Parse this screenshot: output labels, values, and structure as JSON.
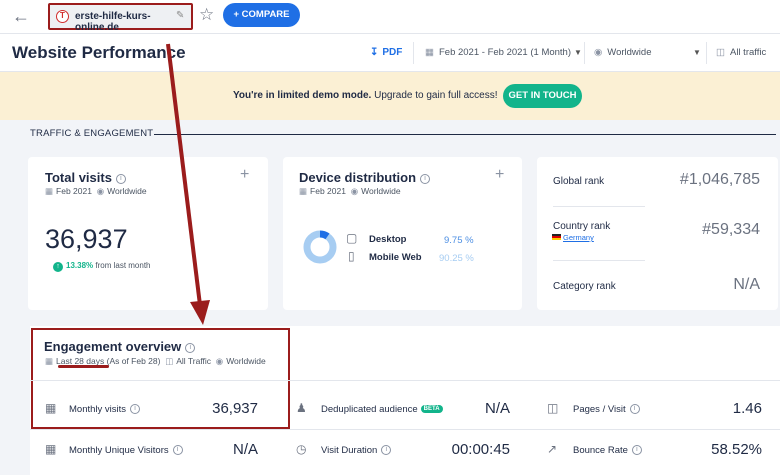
{
  "topbar": {
    "site_name": "erste-hilfe-kurs-online.de",
    "site_favicon_letter": "T",
    "compare_label": "+ COMPARE"
  },
  "header": {
    "title": "Website Performance",
    "pdf_label": "PDF",
    "date_range": "Feb 2021 - Feb 2021 (1 Month)",
    "region": "Worldwide",
    "traffic": "All traffic"
  },
  "banner": {
    "text_bold": "You're in limited demo mode.",
    "text_rest": " Upgrade to gain full access!",
    "cta_label": "GET IN TOUCH"
  },
  "section_label": "TRAFFIC & ENGAGEMENT",
  "total_visits": {
    "title": "Total visits",
    "period": "Feb 2021",
    "region": "Worldwide",
    "value": "36,937",
    "change_pct": "13.38%",
    "change_text": "from last month"
  },
  "device_distribution": {
    "title": "Device distribution",
    "period": "Feb 2021",
    "region": "Worldwide",
    "desktop_label": "Desktop",
    "desktop_pct": "9.75 %",
    "mobile_label": "Mobile Web",
    "mobile_pct": "90.25 %",
    "desktop_fraction": 0.0975
  },
  "ranks": {
    "global_label": "Global rank",
    "global_value": "#1,046,785",
    "country_label": "Country rank",
    "country_name": "Germany",
    "country_value": "#59,334",
    "category_label": "Category rank",
    "category_value": "N/A"
  },
  "engagement": {
    "title": "Engagement overview",
    "period": "Last 28 days",
    "period_note": "(As of Feb 28)",
    "traffic": "All Traffic",
    "region": "Worldwide",
    "monthly_visits_label": "Monthly visits",
    "monthly_visits_value": "36,937",
    "dedup_label": "Deduplicated audience",
    "dedup_badge": "BETA",
    "dedup_value": "N/A",
    "pages_label": "Pages / Visit",
    "pages_value": "1.46",
    "unique_label": "Monthly Unique Visitors",
    "unique_value": "N/A",
    "duration_label": "Visit Duration",
    "duration_value": "00:00:45",
    "bounce_label": "Bounce Rate",
    "bounce_value": "58.52%"
  },
  "colors": {
    "primary": "#1f6fe5",
    "accent_green": "#12b48b",
    "annotation_red": "#9b1c1c",
    "banner_bg": "#fbf0d4"
  }
}
